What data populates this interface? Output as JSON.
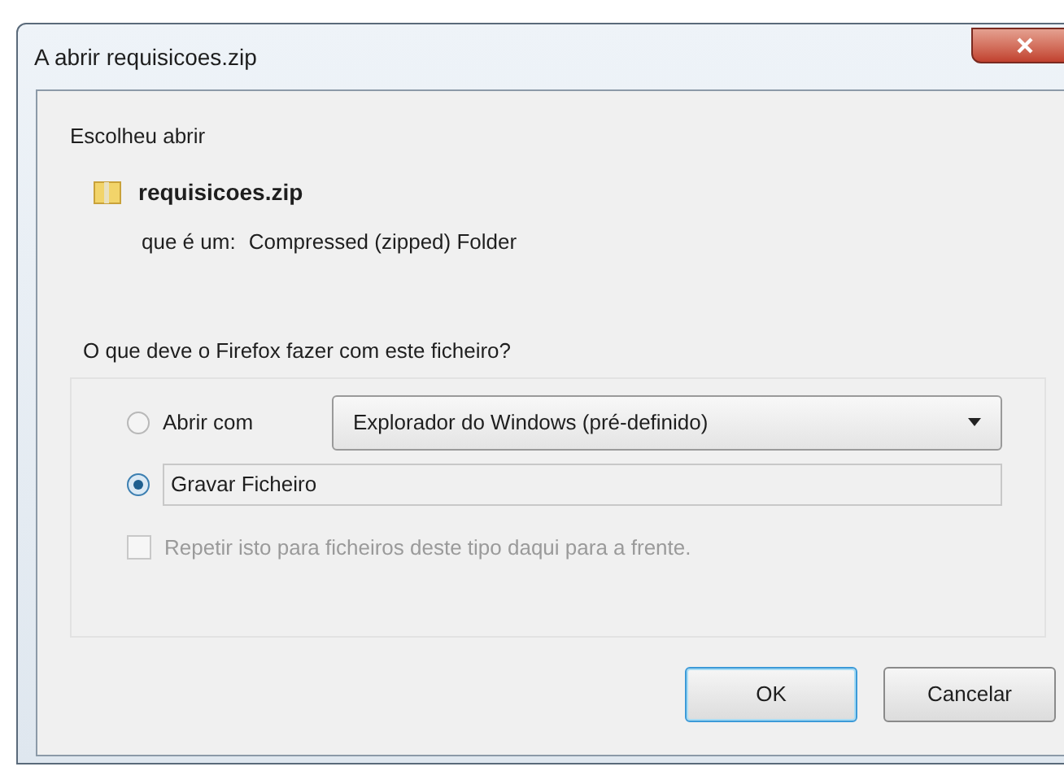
{
  "window": {
    "title": "A abrir requisicoes.zip"
  },
  "intro": "Escolheu abrir",
  "file": {
    "name": "requisicoes.zip",
    "type_label": "que é um:",
    "type": "Compressed (zipped) Folder"
  },
  "question": "O que deve o Firefox fazer com este ficheiro?",
  "options": [
    {
      "label": "Abrir com",
      "selected": false,
      "dropdown": "Explorador do Windows (pré-definido)"
    },
    {
      "label": "Gravar Ficheiro",
      "selected": true
    }
  ],
  "remember": {
    "label": "Repetir isto para ficheiros deste tipo daqui para a frente.",
    "checked": false,
    "disabled": true
  },
  "buttons": [
    {
      "label": "OK",
      "default": true
    },
    {
      "label": "Cancelar",
      "default": false
    }
  ]
}
